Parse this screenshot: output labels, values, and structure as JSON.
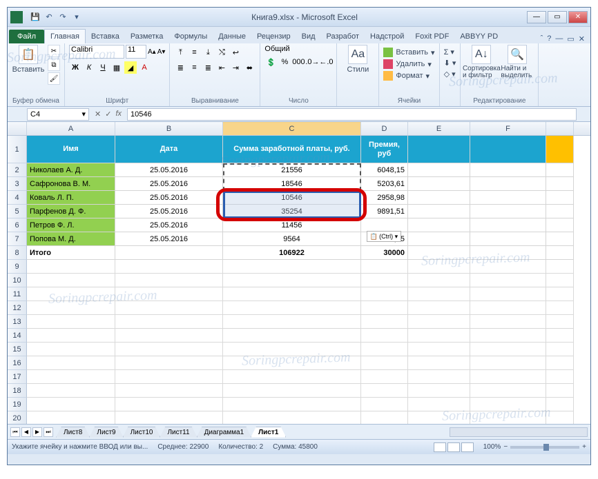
{
  "title": "Книга9.xlsx - Microsoft Excel",
  "ribbon": {
    "file": "Файл",
    "tabs": [
      "Главная",
      "Вставка",
      "Разметка",
      "Формулы",
      "Данные",
      "Рецензир",
      "Вид",
      "Разработ",
      "Надстрой",
      "Foxit PDF",
      "ABBYY PD"
    ],
    "active": 0
  },
  "groups": {
    "clipboard": {
      "paste": "Вставить",
      "label": "Буфер обмена"
    },
    "font": {
      "name": "Calibri",
      "size": "11",
      "label": "Шрифт"
    },
    "align": {
      "label": "Выравнивание"
    },
    "number": {
      "format": "Общий",
      "label": "Число"
    },
    "styles": {
      "btn": "Стили"
    },
    "cells": {
      "insert": "Вставить",
      "delete": "Удалить",
      "format": "Формат",
      "label": "Ячейки"
    },
    "editing": {
      "sort": "Сортировка и фильтр",
      "find": "Найти и выделить",
      "label": "Редактирование"
    }
  },
  "namebox": "C4",
  "formula": "10546",
  "cols": [
    "A",
    "B",
    "C",
    "D",
    "E",
    "F"
  ],
  "headers": {
    "A": "Имя",
    "B": "Дата",
    "C": "Сумма заработной платы, руб.",
    "D": "Премия, руб"
  },
  "rows": [
    {
      "n": "2",
      "A": "Николаев А. Д.",
      "B": "25.05.2016",
      "C": "21556",
      "D": "6048,15"
    },
    {
      "n": "3",
      "A": "Сафронова В. М.",
      "B": "25.05.2016",
      "C": "18546",
      "D": "5203,61"
    },
    {
      "n": "4",
      "A": "Коваль Л. П.",
      "B": "25.05.2016",
      "C": "10546",
      "D": "2958,98"
    },
    {
      "n": "5",
      "A": "Парфенов Д. Ф.",
      "B": "25.05.2016",
      "C": "35254",
      "D": "9891,51"
    },
    {
      "n": "6",
      "A": "Петров Ф. Л.",
      "B": "25.05.2016",
      "C": "11456",
      "D": ""
    },
    {
      "n": "7",
      "A": "Попова М. Д.",
      "B": "25.05.2016",
      "C": "9564",
      "D": "2683,45"
    },
    {
      "n": "8",
      "A": "Итого",
      "B": "",
      "C": "106922",
      "D": "30000",
      "bold": true
    }
  ],
  "emptyrows": [
    "9",
    "10",
    "11",
    "12",
    "13",
    "14",
    "15",
    "16",
    "17",
    "18",
    "19",
    "20"
  ],
  "smarttag": "(Ctrl) ▾",
  "sheets": [
    "Лист8",
    "Лист9",
    "Лист10",
    "Лист11",
    "Диаграмма1",
    "Лист1"
  ],
  "activesheet": 5,
  "status": {
    "mode": "Укажите ячейку и нажмите ВВОД или вы...",
    "avg": "Среднее: 22900",
    "count": "Количество: 2",
    "sum": "Сумма: 45800",
    "zoom": "100%"
  },
  "watermark": "Soringpcrepair.com"
}
